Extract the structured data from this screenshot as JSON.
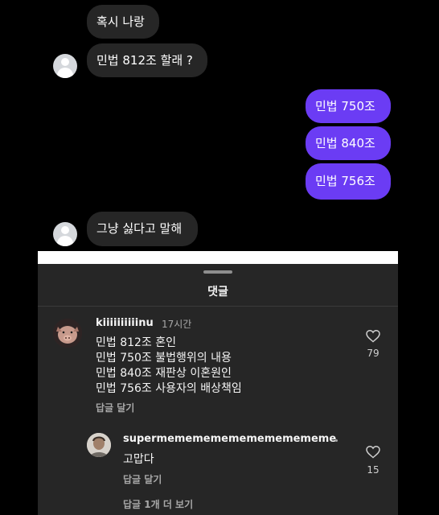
{
  "chat": {
    "messages": [
      {
        "side": "in",
        "text": "혹시 나랑"
      },
      {
        "side": "in",
        "text": "민법 812조 할래 ?"
      },
      {
        "side": "out",
        "text": "민법 750조"
      },
      {
        "side": "out",
        "text": "민법 840조"
      },
      {
        "side": "out",
        "text": "민법 756조"
      },
      {
        "side": "in",
        "text": "그냥 싫다고 말해"
      }
    ]
  },
  "sheet": {
    "title": "댓글"
  },
  "comments": [
    {
      "username": "kiiiiiiiiiinu",
      "time": "17시간",
      "lines": [
        "민법 812조 혼인",
        "민법 750조 불법행위의 내용",
        "민법 840조 재판상 이혼원인",
        "민법 756조 사용자의 배상책임"
      ],
      "reply_label": "답글 달기",
      "likes": "79"
    },
    {
      "username": "supermemememememememememe",
      "text": "고맙다",
      "reply_label": "답글 달기",
      "likes": "15",
      "more_replies": "답글 1개 더 보기"
    }
  ],
  "colors": {
    "outgoing_bubble": "#6b3cf4",
    "incoming_bubble": "#262626",
    "sheet_background": "#262626"
  }
}
